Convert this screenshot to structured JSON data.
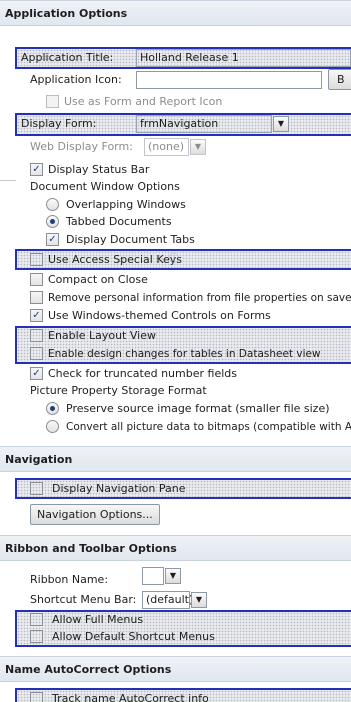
{
  "sections": {
    "application_options": "Application Options",
    "navigation": "Navigation",
    "ribbon": "Ribbon and Toolbar Options",
    "name_autocorrect": "Name AutoCorrect Options"
  },
  "app": {
    "title_label": "Application Title:",
    "title_value": "Holland Release 1",
    "icon_label": "Application Icon:",
    "icon_value": "",
    "browse_label": "B",
    "use_as_form_icon": "Use as Form and Report Icon",
    "display_form_label": "Display Form:",
    "display_form_value": "frmNavigation",
    "web_display_form_label": "Web Display Form:",
    "web_display_form_value": "(none)",
    "display_status_bar": "Display Status Bar",
    "doc_window_options": "Document Window Options",
    "overlapping": "Overlapping Windows",
    "tabbed": "Tabbed Documents",
    "display_tabs": "Display Document Tabs",
    "special_keys": "Use Access Special Keys",
    "compact": "Compact on Close",
    "remove_personal": "Remove personal information from file properties on save",
    "themed_controls": "Use Windows-themed Controls on Forms",
    "layout_view": "Enable Layout View",
    "design_changes": "Enable design changes for tables in Datasheet view",
    "truncated": "Check for truncated number fields",
    "picture_storage": "Picture Property Storage Format",
    "preserve": "Preserve source image format (smaller file size)",
    "convert": "Convert all picture data to bitmaps (compatible with Ac"
  },
  "nav": {
    "display_pane": "Display Navigation Pane",
    "options_button": "Navigation Options..."
  },
  "ribbon": {
    "ribbon_name_label": "Ribbon Name:",
    "ribbon_name_value": "",
    "shortcut_label": "Shortcut Menu Bar:",
    "shortcut_value": "(default)",
    "full_menus": "Allow Full Menus",
    "default_shortcut": "Allow Default Shortcut Menus"
  },
  "autocorrect": {
    "track": "Track name AutoCorrect info"
  },
  "colors": {
    "highlight_border": "#2430b8",
    "check_mark": "#1b3f8f"
  }
}
